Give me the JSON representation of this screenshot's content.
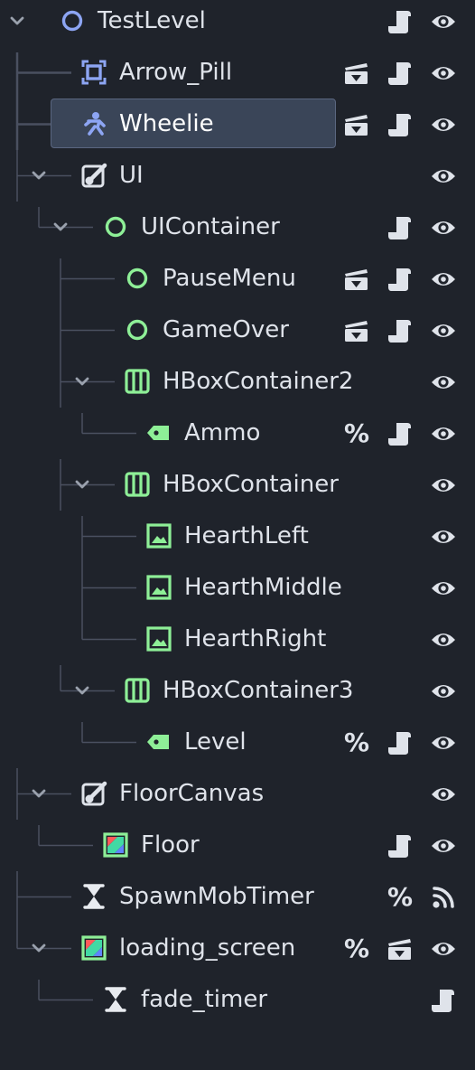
{
  "colors": {
    "background": "#1f232b",
    "selection": "#3a4558",
    "node_blue": "#8da5f3",
    "control_green": "#8eef97",
    "text": "#dfe3ea",
    "guide_line": "#4a5060"
  },
  "tree": [
    {
      "id": "testlevel",
      "label": "TestLevel",
      "depth": 0,
      "expanded": true,
      "icon": "node2d-circle-icon",
      "icons": [
        "script-icon",
        "visibility-icon"
      ]
    },
    {
      "id": "arrow-pill",
      "label": "Arrow_Pill",
      "depth": 1,
      "icon": "area2d-icon",
      "icons": [
        "scene-instance-icon",
        "script-icon",
        "visibility-icon"
      ]
    },
    {
      "id": "wheelie",
      "label": "Wheelie",
      "depth": 1,
      "selected": true,
      "icon": "character-icon",
      "icons": [
        "scene-instance-icon",
        "script-icon",
        "visibility-icon"
      ]
    },
    {
      "id": "ui",
      "label": "UI",
      "depth": 1,
      "expanded": true,
      "icon": "canvas-layer-icon",
      "icons": [
        "visibility-icon"
      ]
    },
    {
      "id": "uicontainer",
      "label": "UIContainer",
      "depth": 2,
      "expanded": true,
      "icon": "control-circle-icon",
      "icons": [
        "script-icon",
        "visibility-icon"
      ]
    },
    {
      "id": "pausemenu",
      "label": "PauseMenu",
      "depth": 3,
      "icon": "control-circle-icon",
      "icons": [
        "scene-instance-icon",
        "script-icon",
        "visibility-icon"
      ]
    },
    {
      "id": "gameover",
      "label": "GameOver",
      "depth": 3,
      "icon": "control-circle-icon",
      "icons": [
        "scene-instance-icon",
        "script-icon",
        "visibility-icon"
      ]
    },
    {
      "id": "hboxcontainer2",
      "label": "HBoxContainer2",
      "depth": 3,
      "expanded": true,
      "icon": "hbox-icon",
      "icons": [
        "visibility-icon"
      ]
    },
    {
      "id": "ammo",
      "label": "Ammo",
      "depth": 4,
      "icon": "label-icon",
      "icons": [
        "unique-name-icon",
        "script-icon",
        "visibility-icon"
      ]
    },
    {
      "id": "hboxcontainer",
      "label": "HBoxContainer",
      "depth": 3,
      "expanded": true,
      "icon": "hbox-icon",
      "icons": [
        "visibility-icon"
      ]
    },
    {
      "id": "hearthleft",
      "label": "HearthLeft",
      "depth": 4,
      "icon": "texture-rect-icon",
      "icons": [
        "visibility-icon"
      ]
    },
    {
      "id": "hearthmiddle",
      "label": "HearthMiddle",
      "depth": 4,
      "icon": "texture-rect-icon",
      "icons": [
        "visibility-icon"
      ]
    },
    {
      "id": "hearthright",
      "label": "HearthRight",
      "depth": 4,
      "icon": "texture-rect-icon",
      "icons": [
        "visibility-icon"
      ]
    },
    {
      "id": "hboxcontainer3",
      "label": "HBoxContainer3",
      "depth": 3,
      "expanded": true,
      "icon": "hbox-icon",
      "icons": [
        "visibility-icon"
      ]
    },
    {
      "id": "level",
      "label": "Level",
      "depth": 4,
      "icon": "label-icon",
      "icons": [
        "unique-name-icon",
        "script-icon",
        "visibility-icon"
      ]
    },
    {
      "id": "floorcanvas",
      "label": "FloorCanvas",
      "depth": 1,
      "expanded": true,
      "icon": "canvas-layer-icon",
      "icons": [
        "visibility-icon"
      ]
    },
    {
      "id": "floor",
      "label": "Floor",
      "depth": 2,
      "icon": "color-rect-icon",
      "icons": [
        "script-icon",
        "visibility-icon"
      ]
    },
    {
      "id": "spawnmobtimer",
      "label": "SpawnMobTimer",
      "depth": 1,
      "icon": "timer-icon",
      "icons": [
        "unique-name-icon",
        "signal-icon"
      ]
    },
    {
      "id": "loading-screen",
      "label": "loading_screen",
      "depth": 1,
      "expanded": true,
      "icon": "color-rect-icon",
      "icons": [
        "unique-name-icon",
        "scene-instance-icon",
        "visibility-icon"
      ]
    },
    {
      "id": "fade-timer",
      "label": "fade_timer",
      "depth": 2,
      "icon": "timer-icon",
      "icons": [
        "script-icon"
      ]
    }
  ],
  "unique_name_symbol": "%"
}
